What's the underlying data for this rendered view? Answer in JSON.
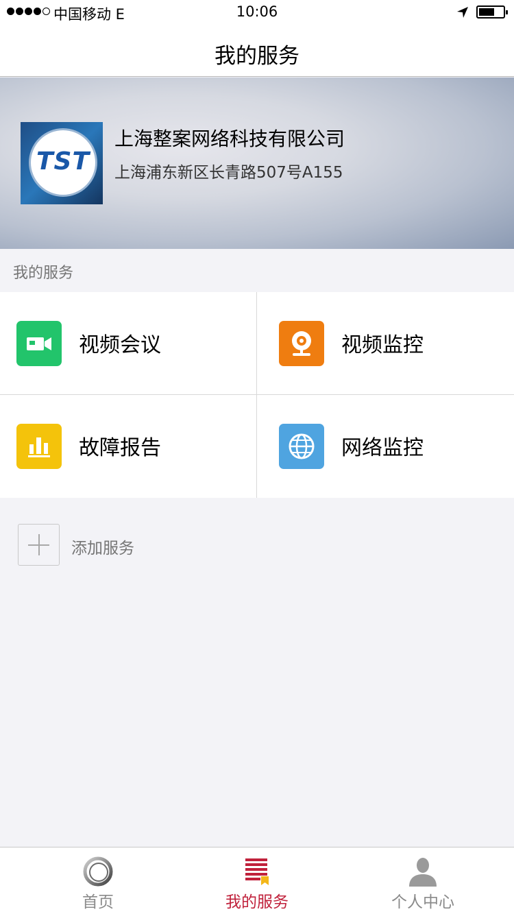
{
  "status_bar": {
    "carrier": "中国移动  E",
    "time": "10:06",
    "battery_level": 0.65
  },
  "nav": {
    "title": "我的服务"
  },
  "company": {
    "logo_text": "TST",
    "name": "上海整案网络科技有限公司",
    "address": "上海浦东新区长青路507号A155"
  },
  "section": {
    "title": "我的服务"
  },
  "services": [
    {
      "label": "视频会议",
      "icon": "video-camera-icon",
      "color": "#22c46b"
    },
    {
      "label": "视频监控",
      "icon": "webcam-icon",
      "color": "#ef7d10"
    },
    {
      "label": "故障报告",
      "icon": "bar-chart-icon",
      "color": "#f4c30b"
    },
    {
      "label": "网络监控",
      "icon": "globe-icon",
      "color": "#4fa4e0"
    }
  ],
  "add_service": {
    "label": "添加服务"
  },
  "tabs": [
    {
      "label": "首页",
      "icon": "ring-icon",
      "active": false
    },
    {
      "label": "我的服务",
      "icon": "list-bookmark-icon",
      "active": true
    },
    {
      "label": "个人中心",
      "icon": "person-icon",
      "active": false
    }
  ],
  "colors": {
    "accent": "#c0213b",
    "secondary_text": "#757575"
  }
}
